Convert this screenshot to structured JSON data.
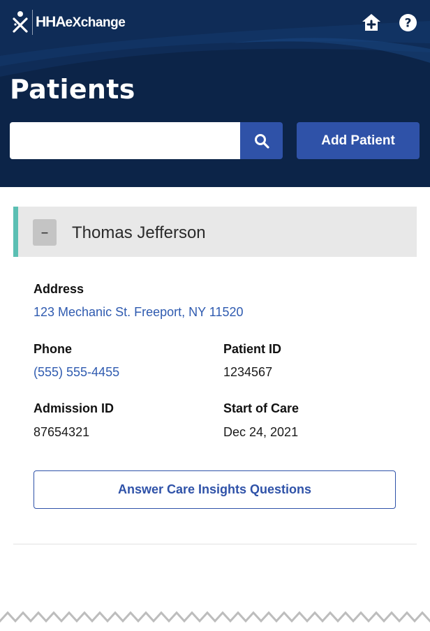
{
  "app": {
    "logo_text_main": "HHA",
    "logo_text_ex": "eXchange",
    "brand_color": "#0c2448",
    "accent_color": "#2f52a8",
    "card_accent_color": "#5bbfb3"
  },
  "header": {
    "icons": [
      "home-plus-icon",
      "help-icon"
    ],
    "title": "Patients"
  },
  "search": {
    "value": "",
    "placeholder": "",
    "button_icon": "search-icon",
    "add_label": "Add Patient"
  },
  "patient": {
    "collapse_symbol": "–",
    "name": "Thomas Jefferson",
    "address_label": "Address",
    "address": "123 Mechanic St. Freeport, NY 11520",
    "phone_label": "Phone",
    "phone": "(555) 555-4455",
    "patient_id_label": "Patient ID",
    "patient_id": "1234567",
    "admission_id_label": "Admission ID",
    "admission_id": "87654321",
    "start_of_care_label": "Start of Care",
    "start_of_care": "Dec 24, 2021",
    "care_button_label": "Answer Care Insights Questions"
  }
}
